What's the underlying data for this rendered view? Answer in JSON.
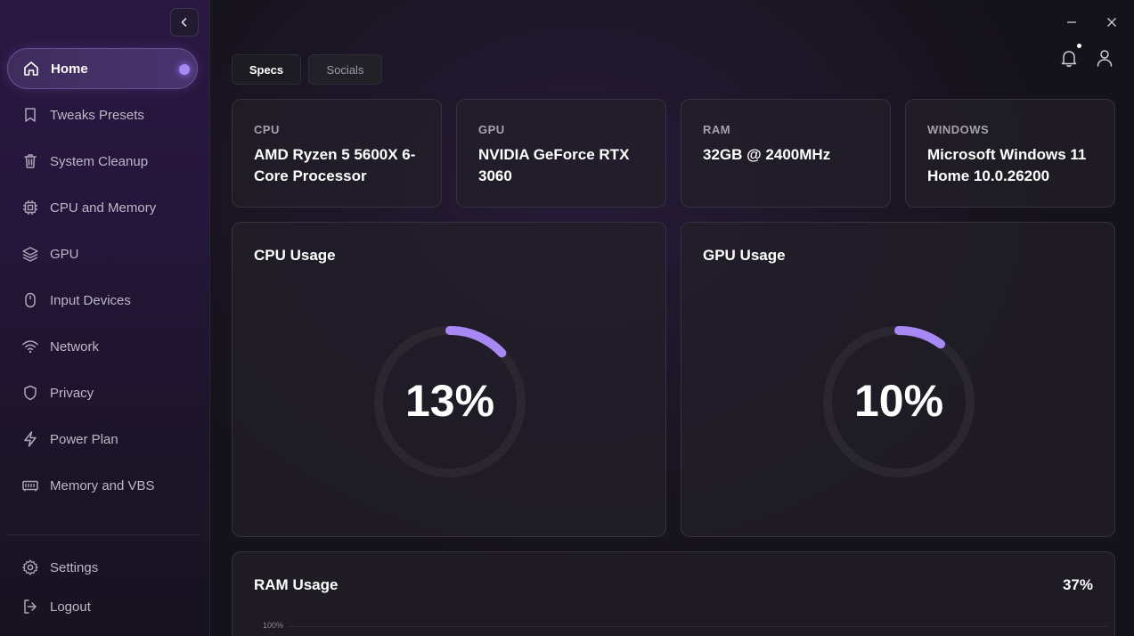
{
  "sidebar": {
    "items": [
      {
        "label": "Home",
        "icon": "home-icon"
      },
      {
        "label": "Tweaks Presets",
        "icon": "bookmark-icon"
      },
      {
        "label": "System Cleanup",
        "icon": "trash-icon"
      },
      {
        "label": "CPU and Memory",
        "icon": "chip-icon"
      },
      {
        "label": "GPU",
        "icon": "layers-icon"
      },
      {
        "label": "Input Devices",
        "icon": "mouse-icon"
      },
      {
        "label": "Network",
        "icon": "wifi-icon"
      },
      {
        "label": "Privacy",
        "icon": "shield-icon"
      },
      {
        "label": "Power Plan",
        "icon": "lightning-icon"
      },
      {
        "label": "Memory and VBS",
        "icon": "memory-icon"
      }
    ],
    "bottom": [
      {
        "label": "Settings",
        "icon": "gear-icon"
      },
      {
        "label": "Logout",
        "icon": "logout-icon"
      }
    ]
  },
  "tabs": [
    {
      "label": "Specs",
      "active": true
    },
    {
      "label": "Socials",
      "active": false
    }
  ],
  "specs": [
    {
      "label": "CPU",
      "value": "AMD Ryzen 5 5600X 6-Core Processor"
    },
    {
      "label": "GPU",
      "value": "NVIDIA GeForce RTX 3060"
    },
    {
      "label": "RAM",
      "value": "32GB @ 2400MHz"
    },
    {
      "label": "WINDOWS",
      "value": "Microsoft Windows 11 Home 10.0.26200"
    }
  ],
  "cpu_usage": {
    "title": "CPU Usage",
    "display": "13%",
    "percent": 13
  },
  "gpu_usage": {
    "title": "GPU Usage",
    "display": "10%",
    "percent": 10
  },
  "ram_usage": {
    "title": "RAM Usage",
    "display": "37%",
    "axis_top": "100%"
  },
  "colors": {
    "accent": "#a888f5",
    "track": "#2a2730"
  }
}
